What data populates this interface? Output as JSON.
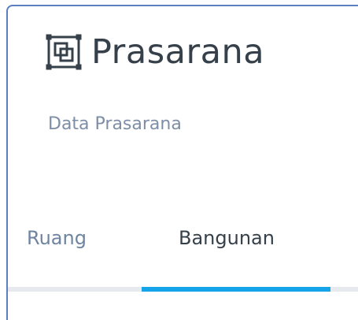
{
  "header": {
    "title": "Prasarana",
    "icon": "prasarana-layers-icon",
    "subtitle": "Data Prasarana"
  },
  "tabs": [
    {
      "label": "Ruang",
      "active": false
    },
    {
      "label": "Bangunan",
      "active": true
    }
  ],
  "colors": {
    "accent": "#15a3ea",
    "card_border": "#5b7fbf",
    "title_text": "#36404a",
    "muted_text": "#7d8ea6",
    "track": "#e6eaef"
  }
}
